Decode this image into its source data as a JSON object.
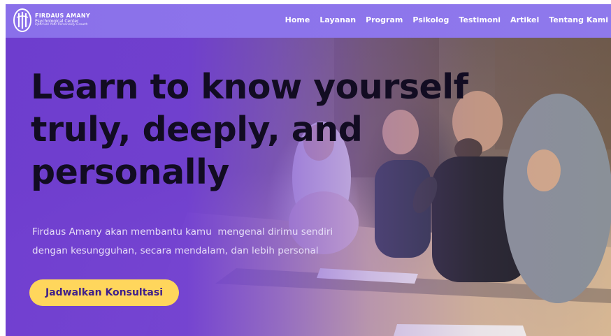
{
  "brand": {
    "name": "FIRDAUS AMANY",
    "subtitle": "Psychological Center",
    "tagline": "Optimize Your Personality Growth"
  },
  "nav": {
    "items": [
      {
        "label": "Home"
      },
      {
        "label": "Layanan"
      },
      {
        "label": "Program"
      },
      {
        "label": "Psikolog"
      },
      {
        "label": "Testimoni"
      },
      {
        "label": "Artikel"
      },
      {
        "label": "Tentang Kami"
      }
    ]
  },
  "hero": {
    "headline_line1": "Learn to know yourself",
    "headline_line2": "truly, deeply, and",
    "headline_line3": "personally",
    "subtitle_line1": "Firdaus Amany akan membantu kamu  mengenal dirimu sendiri",
    "subtitle_line2": "dengan kesungguhan, secara mendalam, dan lebih personal",
    "cta_label": "Jadwalkan Konsultasi"
  },
  "colors": {
    "navbar": "#8a70ea",
    "hero_overlay": "#6e3cd2",
    "headline_text": "#120c22",
    "cta_background": "#ffd65c",
    "cta_text": "#40208a"
  },
  "icons": {
    "logo": "firdaus-amany-logo-icon"
  }
}
